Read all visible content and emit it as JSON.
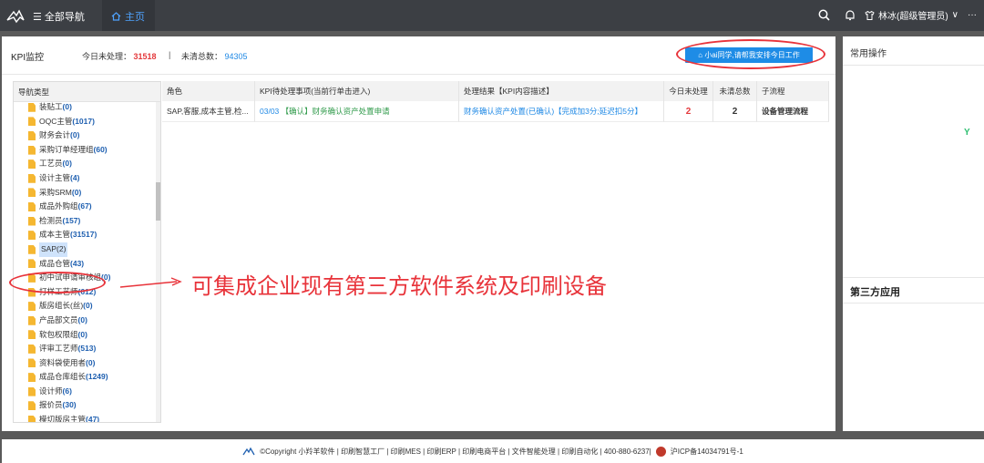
{
  "topbar": {
    "nav_all": "全部导航",
    "nav_home": "主页",
    "user": "林冰(超级管理员)",
    "more": "···"
  },
  "kpi": {
    "title": "KPI监控",
    "unprocessed_label": "今日未处理：",
    "unprocessed_value": "31518",
    "separator": "|",
    "total_label": "未清总数：",
    "total_value": "94305",
    "ai_button": "小ai同学,请帮我安排今日工作"
  },
  "tree": {
    "header": "导航类型",
    "items": [
      {
        "label": "装贴工",
        "count": "(0)"
      },
      {
        "label": "OQC主管",
        "count": "(1017)"
      },
      {
        "label": "财务会计",
        "count": "(0)"
      },
      {
        "label": "采购订单经理组",
        "count": "(60)"
      },
      {
        "label": "工艺员",
        "count": "(0)"
      },
      {
        "label": "设计主管",
        "count": "(4)"
      },
      {
        "label": "采购SRM",
        "count": "(0)"
      },
      {
        "label": "成品外购组",
        "count": "(67)"
      },
      {
        "label": "检测员",
        "count": "(157)"
      },
      {
        "label": "成本主管",
        "count": "(31517)"
      },
      {
        "label": "SAP(2)",
        "count": ""
      },
      {
        "label": "成品仓管",
        "count": "(43)"
      },
      {
        "label": "初中试申请审核组",
        "count": "(0)"
      },
      {
        "label": "打样工艺师",
        "count": "(612)"
      },
      {
        "label": "版房组长(丝)",
        "count": "(0)"
      },
      {
        "label": "产品部文员",
        "count": "(0)"
      },
      {
        "label": "软包权限组",
        "count": "(0)"
      },
      {
        "label": "评审工艺师",
        "count": "(513)"
      },
      {
        "label": "资料袋使用者",
        "count": "(0)"
      },
      {
        "label": "成品仓库组长",
        "count": "(1249)"
      },
      {
        "label": "设计师",
        "count": "(6)"
      },
      {
        "label": "报价员",
        "count": "(30)"
      },
      {
        "label": "模切版房主管",
        "count": "(47)"
      }
    ]
  },
  "table": {
    "headers": [
      "角色",
      "KPI待处理事项(当前行单击进入)",
      "处理结果【KPI内容描述】",
      "今日未处理",
      "未清总数",
      "子流程"
    ],
    "row": {
      "role": "SAP,客服,成本主管,检...",
      "task_index": "03/03",
      "task_text": "【确认】财务确认资产处置申请",
      "result": "财务确认资产处置(已确认)【完成加3分;延迟扣5分】",
      "today": "2",
      "total": "2",
      "sub_flow": "设备管理流程"
    }
  },
  "annotation": "可集成企业现有第三方软件系统及印刷设备",
  "right_panel": {
    "common_ops": "常用操作",
    "third_party": "第三方应用",
    "badge": "Y"
  },
  "footer": {
    "text": "©Copyright 小羚羊软件 | 印刷智慧工厂 | 印刷MES | 印刷ERP | 印刷电商平台 | 文件智能处理 | 印刷自动化 | 400-880-6237|",
    "icp": "沪ICP备14034791号-1"
  },
  "colors": {
    "accent_blue": "#1e8ce6",
    "alert_red": "#e8333a",
    "topbar": "#3c3f44"
  }
}
